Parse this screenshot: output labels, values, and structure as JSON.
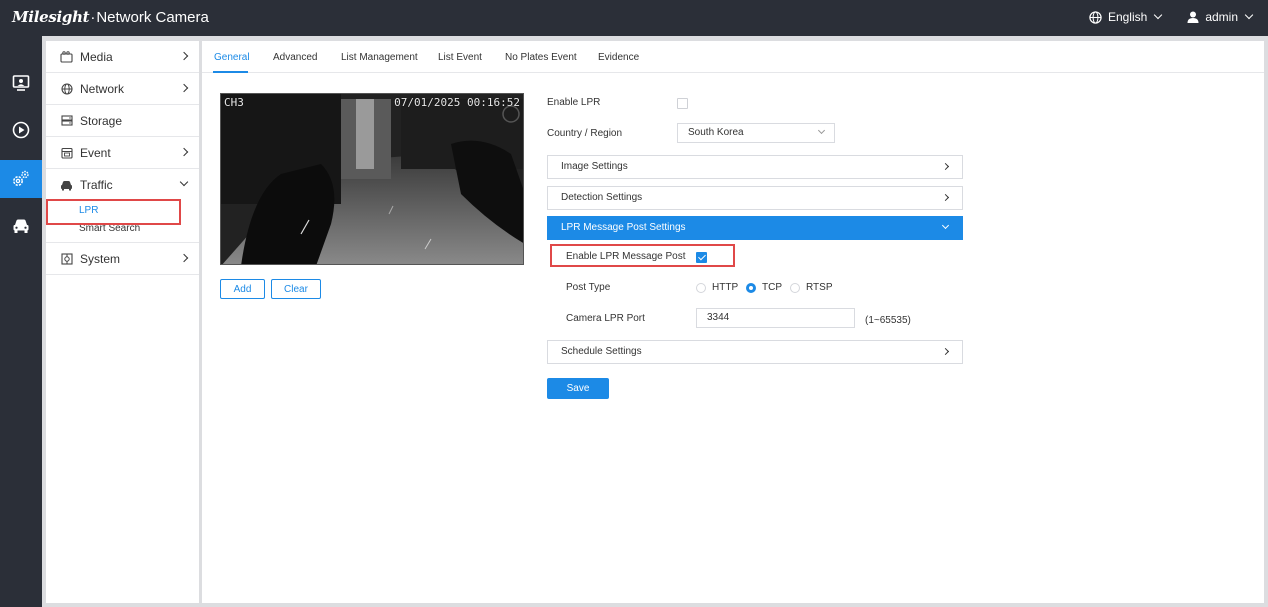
{
  "header": {
    "brand_logo": "Milesight",
    "brand_sep": "·",
    "brand_product": "Network Camera",
    "language": "English",
    "user": "admin"
  },
  "rail": {
    "icons": [
      "live-view-icon",
      "playback-icon",
      "settings-icon",
      "vehicle-icon"
    ],
    "active": "settings-icon"
  },
  "sidebar": {
    "items": [
      {
        "label": "Media",
        "icon": "media-icon"
      },
      {
        "label": "Network",
        "icon": "globe-icon"
      },
      {
        "label": "Storage",
        "icon": "storage-icon"
      },
      {
        "label": "Event",
        "icon": "event-icon"
      },
      {
        "label": "Traffic",
        "icon": "car-icon"
      },
      {
        "label": "System",
        "icon": "system-icon"
      }
    ],
    "traffic_sub": [
      "LPR",
      "Smart Search"
    ],
    "active_sub": "LPR"
  },
  "tabs": [
    "General",
    "Advanced",
    "List Management",
    "List Event",
    "No Plates Event",
    "Evidence"
  ],
  "active_tab": "General",
  "video": {
    "channel": "CH3",
    "timestamp": "07/01/2025 00:16:52"
  },
  "buttons": {
    "add": "Add",
    "clear": "Clear",
    "save": "Save"
  },
  "form": {
    "enable_lpr_label": "Enable LPR",
    "enable_lpr_checked": false,
    "country_label": "Country / Region",
    "country_value": "South Korea"
  },
  "sections": {
    "image": "Image Settings",
    "detection": "Detection Settings",
    "message_post": "LPR Message Post Settings",
    "schedule": "Schedule Settings"
  },
  "message_post": {
    "enable_label": "Enable LPR Message Post",
    "enable_checked": true,
    "post_type_label": "Post Type",
    "post_type_options": [
      "HTTP",
      "TCP",
      "RTSP"
    ],
    "post_type_selected": "TCP",
    "port_label": "Camera LPR Port",
    "port_value": "3344",
    "port_range": "(1~65535)"
  },
  "colors": {
    "accent": "#1c8ae6",
    "header_bg": "#2b2f38",
    "highlight": "#e04848"
  }
}
